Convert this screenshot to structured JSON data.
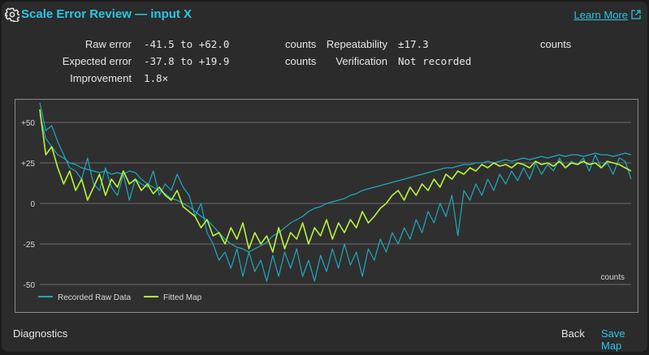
{
  "dialog": {
    "title": "Scale Error Review — input X",
    "learn_more": "Learn More",
    "icons": {
      "settings": "gear-icon",
      "external": "external-link-icon"
    }
  },
  "stats": {
    "raw_error_label": "Raw error",
    "raw_error_value": "-41.5 to +62.0",
    "raw_error_unit": "counts",
    "repeatability_label": "Repeatability",
    "repeatability_value": "±17.3",
    "repeatability_unit": "counts",
    "expected_error_label": "Expected error",
    "expected_error_value": "-37.8 to +19.9",
    "expected_error_unit": "counts",
    "verification_label": "Verification",
    "verification_value": "Not recorded",
    "improvement_label": "Improvement",
    "improvement_value": "1.8×"
  },
  "chart_data": {
    "type": "line",
    "ylabel": "counts",
    "ylim": [
      -50,
      62
    ],
    "yticks": [
      50,
      25,
      0,
      -25,
      -50
    ],
    "ytick_labels": [
      "+50",
      "+25",
      "0",
      "-25",
      "-50"
    ],
    "grid": true,
    "legend_position": "bottom-left",
    "series": [
      {
        "name": "Recorded Raw Data",
        "color": "#1fa9bd",
        "values": [
          62,
          45,
          48,
          38,
          30,
          22,
          20,
          15,
          28,
          12,
          8,
          22,
          10,
          5,
          18,
          2,
          15,
          12,
          10,
          20,
          5,
          12,
          8,
          18,
          10,
          5,
          -8,
          0,
          -18,
          -25,
          -35,
          -30,
          -40,
          -28,
          -45,
          -30,
          -42,
          -35,
          -48,
          -32,
          -45,
          -30,
          -40,
          -28,
          -45,
          -35,
          -48,
          -32,
          -42,
          -28,
          -40,
          -25,
          -38,
          -30,
          -45,
          -28,
          -35,
          -22,
          -30,
          -18,
          -25,
          -15,
          -22,
          -10,
          -18,
          -5,
          -12,
          0,
          -8,
          5,
          -20,
          8,
          2,
          12,
          5,
          15,
          8,
          18,
          12,
          20,
          14,
          22,
          15,
          25,
          18,
          24,
          20,
          28,
          22,
          26,
          24,
          28,
          20,
          30,
          22,
          25,
          18,
          28,
          26,
          15
        ]
      },
      {
        "name": "",
        "color": "#1fa9bd",
        "values": [
          55,
          40,
          35,
          30,
          28,
          25,
          24,
          22,
          21,
          20,
          19,
          20,
          18,
          19,
          18,
          20,
          19,
          15,
          12,
          10,
          8,
          6,
          3,
          2,
          0,
          -2,
          -5,
          -8,
          -10,
          -14,
          -18,
          -22,
          -25,
          -27,
          -28,
          -30,
          -28,
          -26,
          -24,
          -20,
          -18,
          -15,
          -12,
          -10,
          -8,
          -5,
          -3,
          -2,
          0,
          1,
          2,
          3,
          5,
          6,
          8,
          9,
          10,
          11,
          12,
          13,
          14,
          15,
          16,
          17,
          18,
          19,
          20,
          21,
          22,
          22,
          23,
          24,
          24,
          25,
          25,
          26,
          25,
          26,
          27,
          26,
          27,
          28,
          27,
          28,
          29,
          28,
          29,
          30,
          29,
          30,
          30,
          29,
          30,
          31,
          30,
          30,
          29,
          30,
          31,
          30
        ]
      },
      {
        "name": "Fitted Map",
        "color": "#b8f53a",
        "values": [
          58,
          30,
          35,
          22,
          12,
          20,
          8,
          15,
          2,
          10,
          18,
          5,
          15,
          10,
          20,
          12,
          15,
          8,
          12,
          6,
          10,
          5,
          2,
          8,
          -2,
          -5,
          -8,
          -15,
          -10,
          -20,
          -18,
          -25,
          -15,
          -22,
          -12,
          -28,
          -18,
          -25,
          -20,
          -30,
          -15,
          -28,
          -18,
          -22,
          -12,
          -25,
          -15,
          -20,
          -10,
          -22,
          -12,
          -18,
          -10,
          -15,
          -5,
          -12,
          -8,
          -3,
          0,
          5,
          8,
          2,
          10,
          5,
          12,
          8,
          15,
          10,
          18,
          15,
          20,
          18,
          22,
          20,
          24,
          22,
          25,
          23,
          24,
          22,
          25,
          24,
          22,
          26,
          24,
          25,
          23,
          26,
          22,
          25,
          24,
          26,
          24,
          25,
          22,
          26,
          25,
          24,
          22,
          20
        ]
      }
    ]
  },
  "footer": {
    "diagnostics": "Diagnostics",
    "back": "Back",
    "save": "Save Map"
  }
}
